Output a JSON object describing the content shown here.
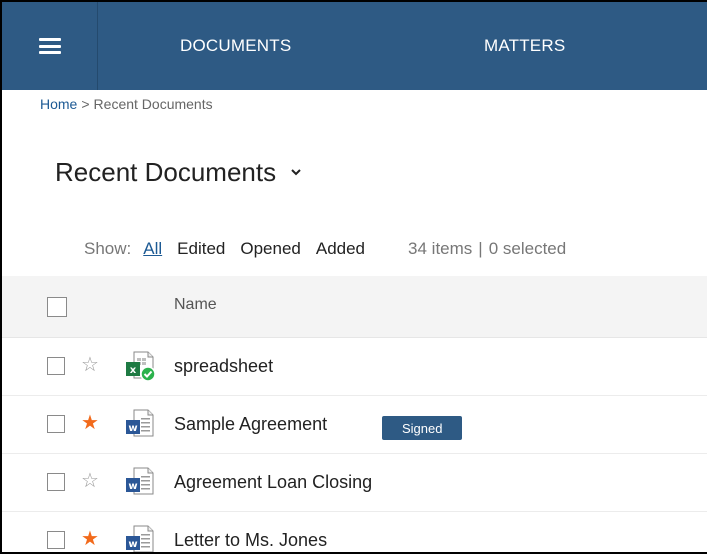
{
  "nav": {
    "menu_icon": "hamburger-icon",
    "items": [
      {
        "label": "DOCUMENTS"
      },
      {
        "label": "MATTERS"
      }
    ]
  },
  "breadcrumb": {
    "home": "Home",
    "separator": ">",
    "current": "Recent Documents"
  },
  "page": {
    "title": "Recent Documents",
    "title_icon": "chevron-down-icon"
  },
  "filters": {
    "show_label": "Show:",
    "options": [
      {
        "label": "All",
        "active": true
      },
      {
        "label": "Edited",
        "active": false
      },
      {
        "label": "Opened",
        "active": false
      },
      {
        "label": "Added",
        "active": false
      }
    ],
    "items_count": "34 items",
    "separator": "|",
    "selected_count": "0 selected"
  },
  "table": {
    "columns": {
      "name": "Name"
    },
    "rows": [
      {
        "name": "spreadsheet",
        "starred": false,
        "file_type": "excel-checked-icon",
        "badge": ""
      },
      {
        "name": "Sample Agreement",
        "starred": true,
        "file_type": "word-icon",
        "badge": "Signed"
      },
      {
        "name": "Agreement Loan Closing",
        "starred": false,
        "file_type": "word-icon",
        "badge": ""
      },
      {
        "name": "Letter to Ms. Jones",
        "starred": true,
        "file_type": "word-icon",
        "badge": ""
      }
    ]
  },
  "colors": {
    "primary": "#2e5a84",
    "link": "#1d5a94",
    "star_active": "#f26a1b",
    "excel_green": "#1e7a43",
    "word_blue": "#2b5797"
  }
}
